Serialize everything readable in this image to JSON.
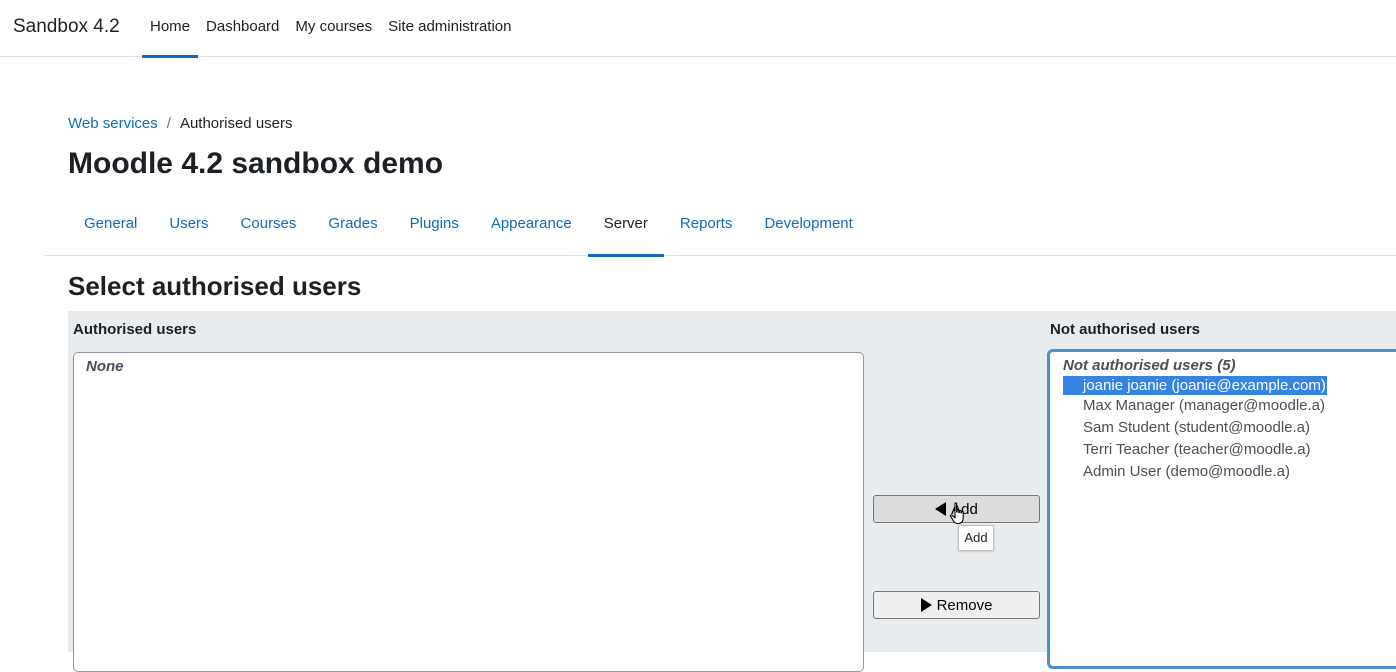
{
  "app": {
    "brand": "Sandbox 4.2"
  },
  "primary_nav": {
    "items": [
      {
        "label": "Home",
        "active": true
      },
      {
        "label": "Dashboard",
        "active": false
      },
      {
        "label": "My courses",
        "active": false
      },
      {
        "label": "Site administration",
        "active": false
      }
    ]
  },
  "breadcrumb": {
    "parent": "Web services",
    "separator": "/",
    "current": "Authorised users"
  },
  "page_title": "Moodle 4.2 sandbox demo",
  "secondary_nav": {
    "tabs": [
      {
        "label": "General",
        "active": false
      },
      {
        "label": "Users",
        "active": false
      },
      {
        "label": "Courses",
        "active": false
      },
      {
        "label": "Grades",
        "active": false
      },
      {
        "label": "Plugins",
        "active": false
      },
      {
        "label": "Appearance",
        "active": false
      },
      {
        "label": "Server",
        "active": true
      },
      {
        "label": "Reports",
        "active": false
      },
      {
        "label": "Development",
        "active": false
      }
    ]
  },
  "section_heading": "Select authorised users",
  "selector": {
    "authorised": {
      "label": "Authorised users",
      "group_label": "None",
      "options": []
    },
    "not_authorised": {
      "label": "Not authorised users",
      "group_label": "Not authorised users (5)",
      "options": [
        {
          "label": "joanie joanie (joanie@example.com)",
          "selected": true
        },
        {
          "label": "Max Manager (manager@moodle.a)",
          "selected": false
        },
        {
          "label": "Sam Student (student@moodle.a)",
          "selected": false
        },
        {
          "label": "Terri Teacher (teacher@moodle.a)",
          "selected": false
        },
        {
          "label": "Admin User (demo@moodle.a)",
          "selected": false
        }
      ]
    },
    "add_button_label": "Add",
    "remove_button_label": "Remove",
    "tooltip": "Add"
  },
  "colors": {
    "link": "#0f6cbf",
    "active_indicator": "#0f6cbf",
    "selection": "#3584e4",
    "focus_border": "#4a8fd0",
    "panel_background": "#e9ecef"
  },
  "icons": {
    "add_button_icon": "triangle-left-icon",
    "remove_button_icon": "triangle-right-icon",
    "cursor": "hand-pointer-icon"
  }
}
